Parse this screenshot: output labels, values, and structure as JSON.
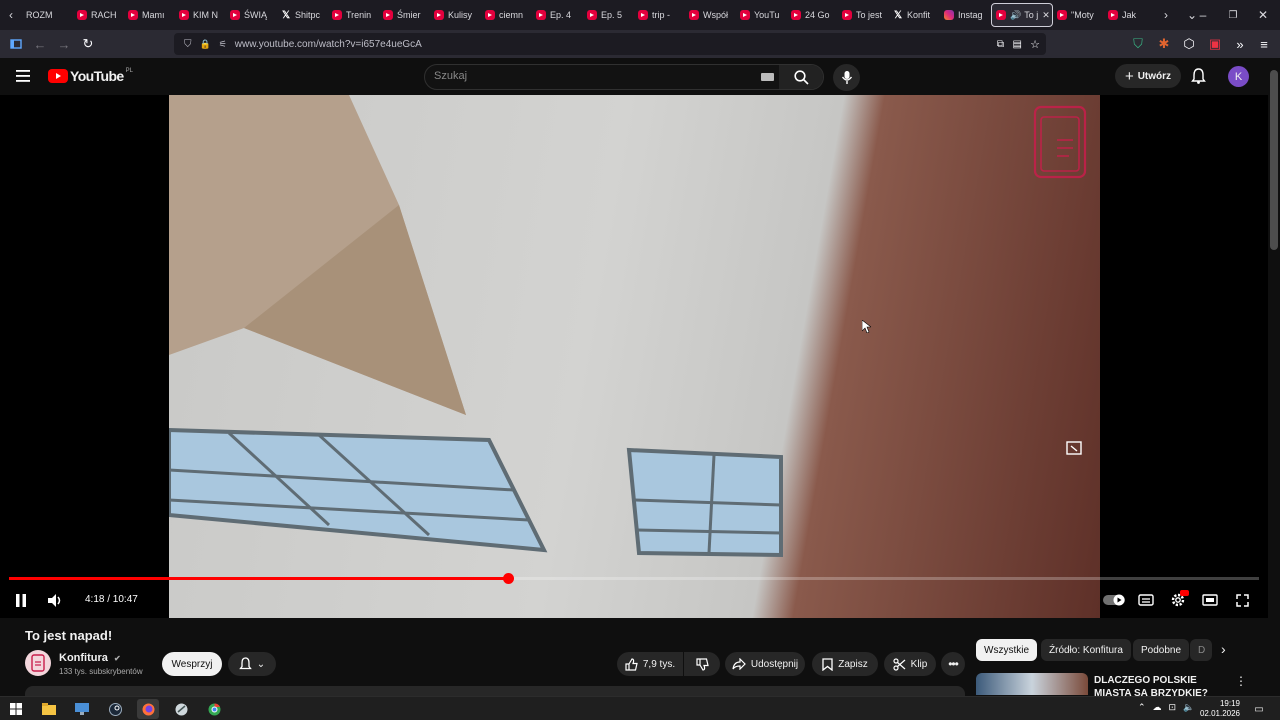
{
  "browser": {
    "tabs": [
      {
        "label": "ROZM",
        "icon": "none"
      },
      {
        "label": "RACH",
        "icon": "youtube-icon"
      },
      {
        "label": "Mamı",
        "icon": "youtube-icon"
      },
      {
        "label": "KIM N",
        "icon": "youtube-icon"
      },
      {
        "label": "ŚWIĄ",
        "icon": "youtube-icon"
      },
      {
        "label": "Shitpc",
        "icon": "x-icon"
      },
      {
        "label": "Trenin",
        "icon": "youtube-icon"
      },
      {
        "label": "Śmier",
        "icon": "youtube-icon"
      },
      {
        "label": "Kulisy",
        "icon": "youtube-icon"
      },
      {
        "label": "ciemn",
        "icon": "youtube-icon"
      },
      {
        "label": "Ep. 4",
        "icon": "youtube-icon"
      },
      {
        "label": "Ep. 5",
        "icon": "youtube-icon"
      },
      {
        "label": "trip -",
        "icon": "youtube-icon"
      },
      {
        "label": "Współ",
        "icon": "youtube-icon"
      },
      {
        "label": "YouTu",
        "icon": "youtube-icon"
      },
      {
        "label": "24 Go",
        "icon": "youtube-icon"
      },
      {
        "label": "To jest",
        "icon": "youtube-icon"
      },
      {
        "label": "Konfit",
        "icon": "x-icon"
      },
      {
        "label": "Instag",
        "icon": "instagram-icon"
      }
    ],
    "active_tab": {
      "label": "To j",
      "icon": "youtube-icon"
    },
    "after_tabs": [
      {
        "label": "\"Moty",
        "icon": "youtube-icon"
      },
      {
        "label": "Jak",
        "icon": "youtube-icon"
      }
    ],
    "url": "www.youtube.com/watch?v=i657e4ueGcA"
  },
  "youtube": {
    "logo_text": "YouTube",
    "logo_region": "PL",
    "search_placeholder": "Szukaj",
    "create_label": "Utwórz",
    "avatar_letter": "K"
  },
  "player": {
    "progress": 0.399,
    "current_time": "4:18",
    "duration": "10:47",
    "time_display": "4:18 / 10:47"
  },
  "video": {
    "title": "To jest napad!",
    "channel": "Konfitura",
    "subscribers": "133 tys. subskrybentów",
    "support_label": "Wesprzyj",
    "likes": "7,9 tys.",
    "share_label": "Udostępnij",
    "save_label": "Zapisz",
    "clip_label": "Klip"
  },
  "sidebar": {
    "chips": [
      "Wszystkie",
      "Źródło: Konfitura",
      "Podobne",
      "D"
    ],
    "recommendation_title": "DLACZEGO POLSKIE MIASTA SĄ BRZYDKIE?"
  },
  "taskbar": {
    "time": "19:19",
    "date": "02.01.2026"
  },
  "colors": {
    "youtube_red": "#ff0000",
    "tab_youtube": "#e3003d",
    "avatar": "#7a4cc7"
  }
}
